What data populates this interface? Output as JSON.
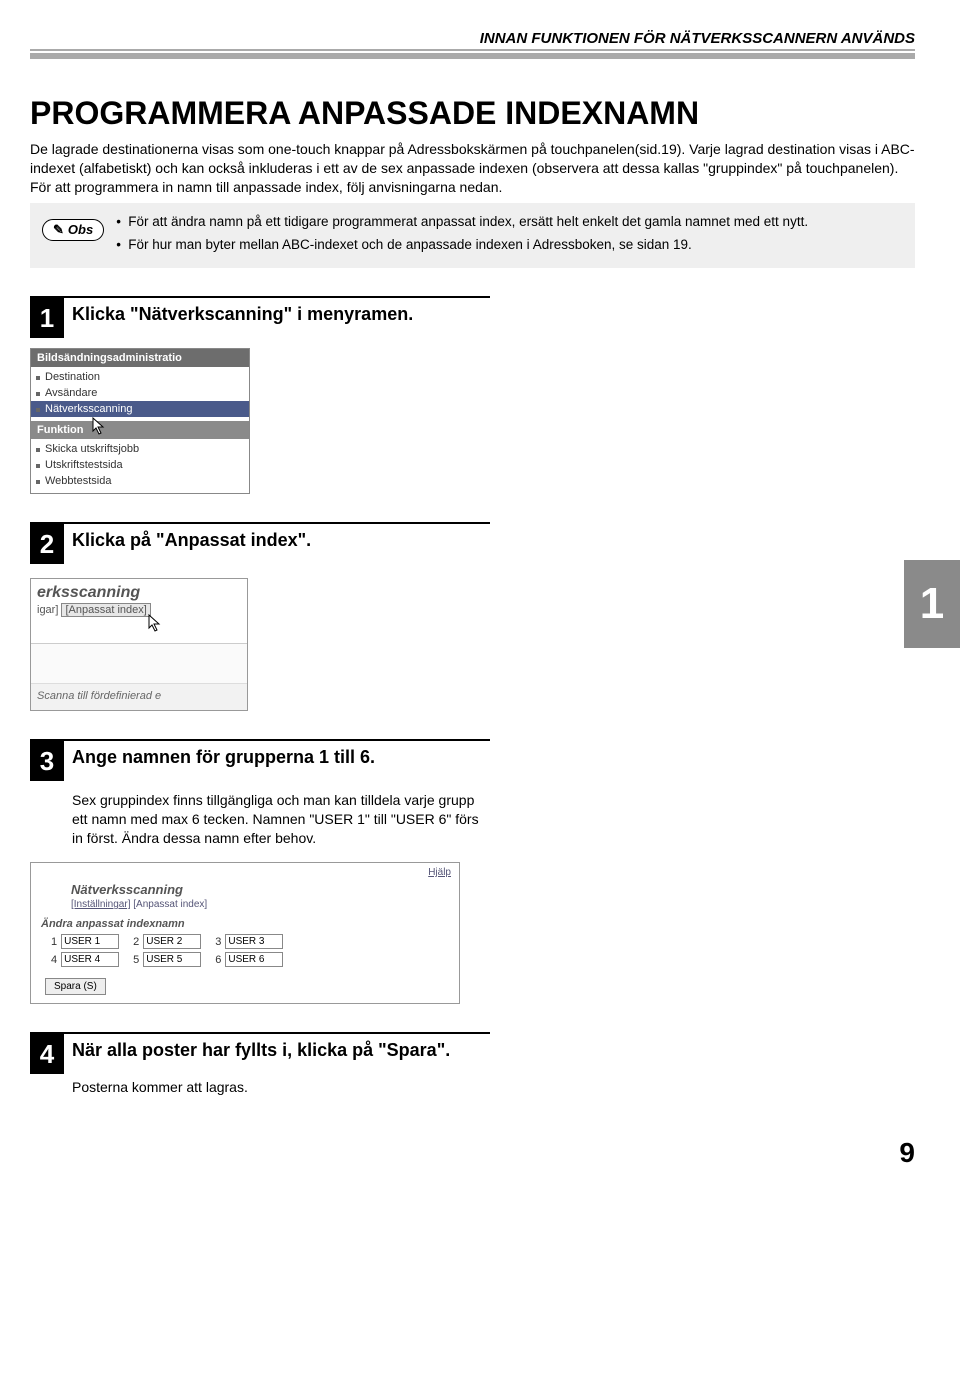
{
  "header": "INNAN FUNKTIONEN FÖR NÄTVERKSSCANNERN ANVÄNDS",
  "title": "PROGRAMMERA ANPASSADE INDEXNAMN",
  "intro": "De lagrade destinationerna visas som one-touch knappar på Adressbokskärmen på touchpanelen(sid.19). Varje lagrad destination visas i ABC-indexet (alfabetiskt) och kan också inkluderas i ett av de sex anpassade indexen (observera att dessa kallas \"gruppindex\" på touchpanelen). För att programmera in namn till anpassade index, följ anvisningarna nedan.",
  "obs": {
    "label": "Obs",
    "items": [
      "För att ändra namn på ett tidigare programmerat anpassat index, ersätt helt enkelt det gamla namnet med ett nytt.",
      "För hur man byter mellan ABC-indexet och de anpassade indexen i Adressboken, se sidan 19."
    ]
  },
  "steps": [
    {
      "num": "1",
      "title": "Klicka \"Nätverkscanning\" i menyramen."
    },
    {
      "num": "2",
      "title": "Klicka på \"Anpassat index\"."
    },
    {
      "num": "3",
      "title": "Ange namnen för grupperna 1 till 6.",
      "desc": "Sex gruppindex finns tillgängliga och man kan tilldela varje grupp ett namn med max 6 tecken. Namnen \"USER 1\" till \"USER 6\" förs in först. Ändra dessa namn efter behov."
    },
    {
      "num": "4",
      "title": "När alla poster har fyllts i, klicka på \"Spara\".",
      "desc": "Posterna kommer att lagras."
    }
  ],
  "mock1": {
    "heading": "Bildsändningsadministratio",
    "items_top": [
      "Destination",
      "Avsändare"
    ],
    "selected": "Nätverksscanning",
    "sub_heading": "Funktion",
    "items_bottom": [
      "Skicka utskriftsjobb",
      "Utskriftstestsida",
      "Webbtestsida"
    ]
  },
  "mock2": {
    "title": "erksscanning",
    "crumb_prefix": "igar]",
    "crumb_box": "[Anpassat index]",
    "footer": "Scanna till fördefinierad e"
  },
  "mock3": {
    "help": "Hjälp",
    "title": "Nätverksscanning",
    "crumb_left": "[Inställningar]",
    "crumb_right": "[Anpassat index]",
    "subtitle": "Ändra anpassat indexnamn",
    "fields": [
      {
        "n": "1",
        "v": "USER 1"
      },
      {
        "n": "2",
        "v": "USER 2"
      },
      {
        "n": "3",
        "v": "USER 3"
      },
      {
        "n": "4",
        "v": "USER 4"
      },
      {
        "n": "5",
        "v": "USER 5"
      },
      {
        "n": "6",
        "v": "USER 6"
      }
    ],
    "button": "Spara (S)"
  },
  "side_tab": "1",
  "page_number": "9"
}
